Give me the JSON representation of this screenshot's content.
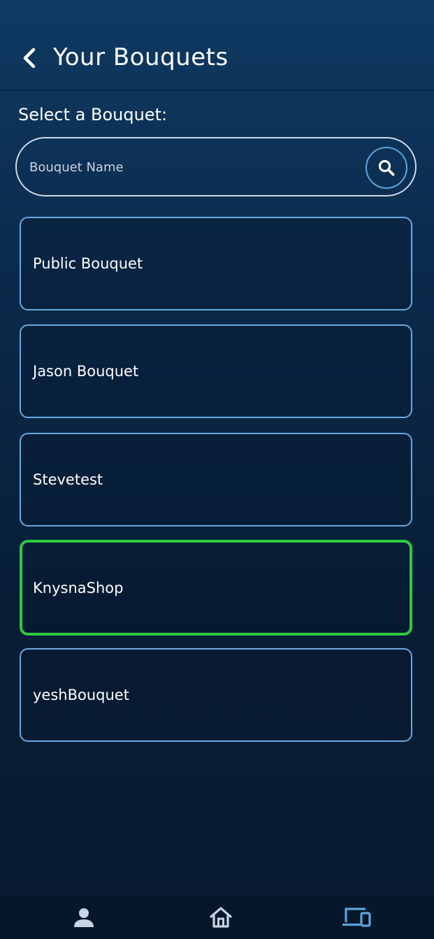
{
  "header": {
    "title": "Your Bouquets",
    "back_icon": "chevron-left-icon"
  },
  "section": {
    "label": "Select a Bouquet:"
  },
  "search": {
    "placeholder": "Bouquet Name",
    "value": "",
    "icon": "search-icon"
  },
  "bouquets": [
    {
      "label": "Public Bouquet",
      "selected": false
    },
    {
      "label": "Jason Bouquet",
      "selected": false
    },
    {
      "label": "Stevetest",
      "selected": false
    },
    {
      "label": "KnysnaShop",
      "selected": true
    },
    {
      "label": "yeshBouquet",
      "selected": false
    }
  ],
  "bottom_nav": {
    "items": [
      {
        "icon": "person-icon",
        "active": false
      },
      {
        "icon": "home-icon",
        "active": false
      },
      {
        "icon": "devices-icon",
        "active": true
      }
    ]
  },
  "colors": {
    "card_border": "#6aa8e0",
    "selected_border": "#2ec93f",
    "accent": "#5ea5dc",
    "nav_inactive": "#c9d3e1",
    "nav_active": "#5ea5dc"
  }
}
